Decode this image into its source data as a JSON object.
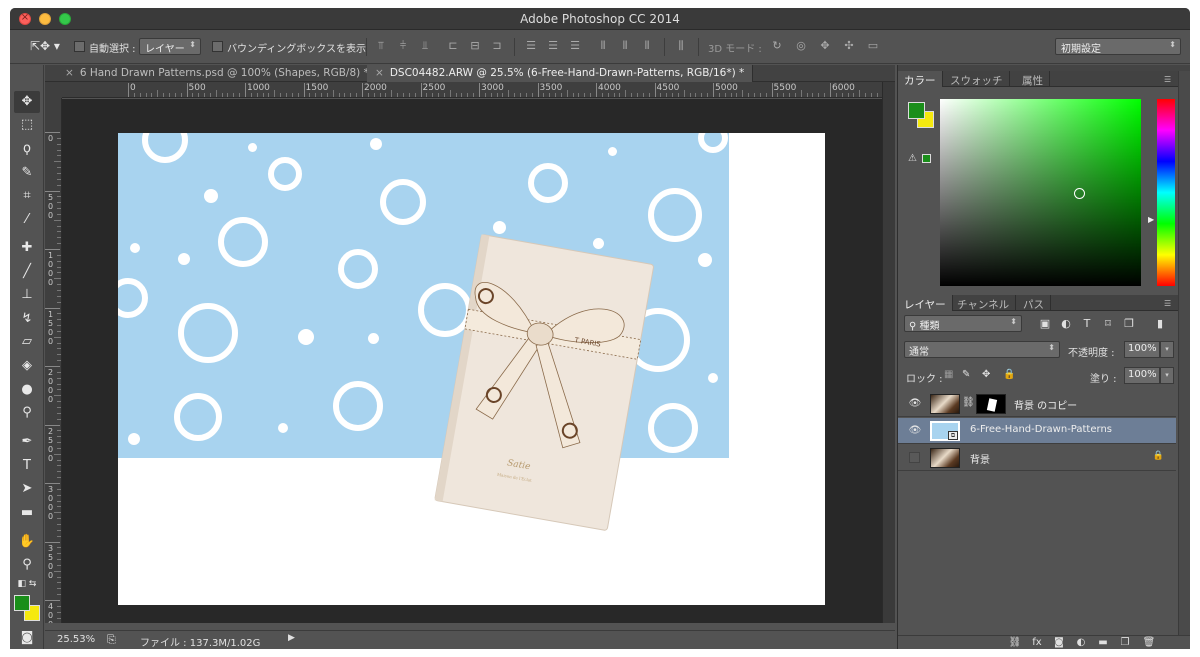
{
  "window": {
    "title": "Adobe Photoshop CC 2014"
  },
  "options_bar": {
    "auto_select_label": "自動選択 :",
    "auto_select_target": "レイヤー",
    "bounding_box_label": "バウンディングボックスを表示",
    "mode_3d_label": "3D モード :",
    "workspace": "初期設定"
  },
  "tabs": [
    {
      "label": "6 Hand Drawn Patterns.psd @ 100% (Shapes, RGB/8) *",
      "active": false
    },
    {
      "label": "DSC04482.ARW @ 25.5% (6-Free-Hand-Drawn-Patterns, RGB/16*) *",
      "active": true
    }
  ],
  "ruler_h": [
    "0",
    "500",
    "1000",
    "1500",
    "2000",
    "2500",
    "3000",
    "3500",
    "4000",
    "4500",
    "5000",
    "5500",
    "6000"
  ],
  "ruler_v": [
    "0",
    "500",
    "1000",
    "1500",
    "2000",
    "2500",
    "3000",
    "3500",
    "4000"
  ],
  "status": {
    "zoom": "25.53%",
    "doc": "ファイル : 137.3M/1.02G"
  },
  "color_panel": {
    "tabs": [
      "カラー",
      "スウォッチ",
      "属性"
    ],
    "foreground": "#1a8e1a",
    "background": "#f5e90e"
  },
  "layers_panel": {
    "tabs": [
      "レイヤー",
      "チャンネル",
      "パス"
    ],
    "filter_kind": "種類",
    "blend_mode": "通常",
    "opacity_label": "不透明度 :",
    "opacity": "100%",
    "lock_label": "ロック :",
    "fill_label": "塗り :",
    "fill": "100%",
    "layers": [
      {
        "name": "背景 のコピー",
        "visible": true,
        "selected": false,
        "locked": false
      },
      {
        "name": "6-Free-Hand-Drawn-Patterns",
        "visible": true,
        "selected": true,
        "locked": false
      },
      {
        "name": "背景",
        "visible": false,
        "selected": false,
        "locked": true
      }
    ]
  },
  "photo": {
    "brand": "Satie",
    "ribbon_text": "T PARIS",
    "cover_subtitle": "Maison de l'Eclat"
  }
}
